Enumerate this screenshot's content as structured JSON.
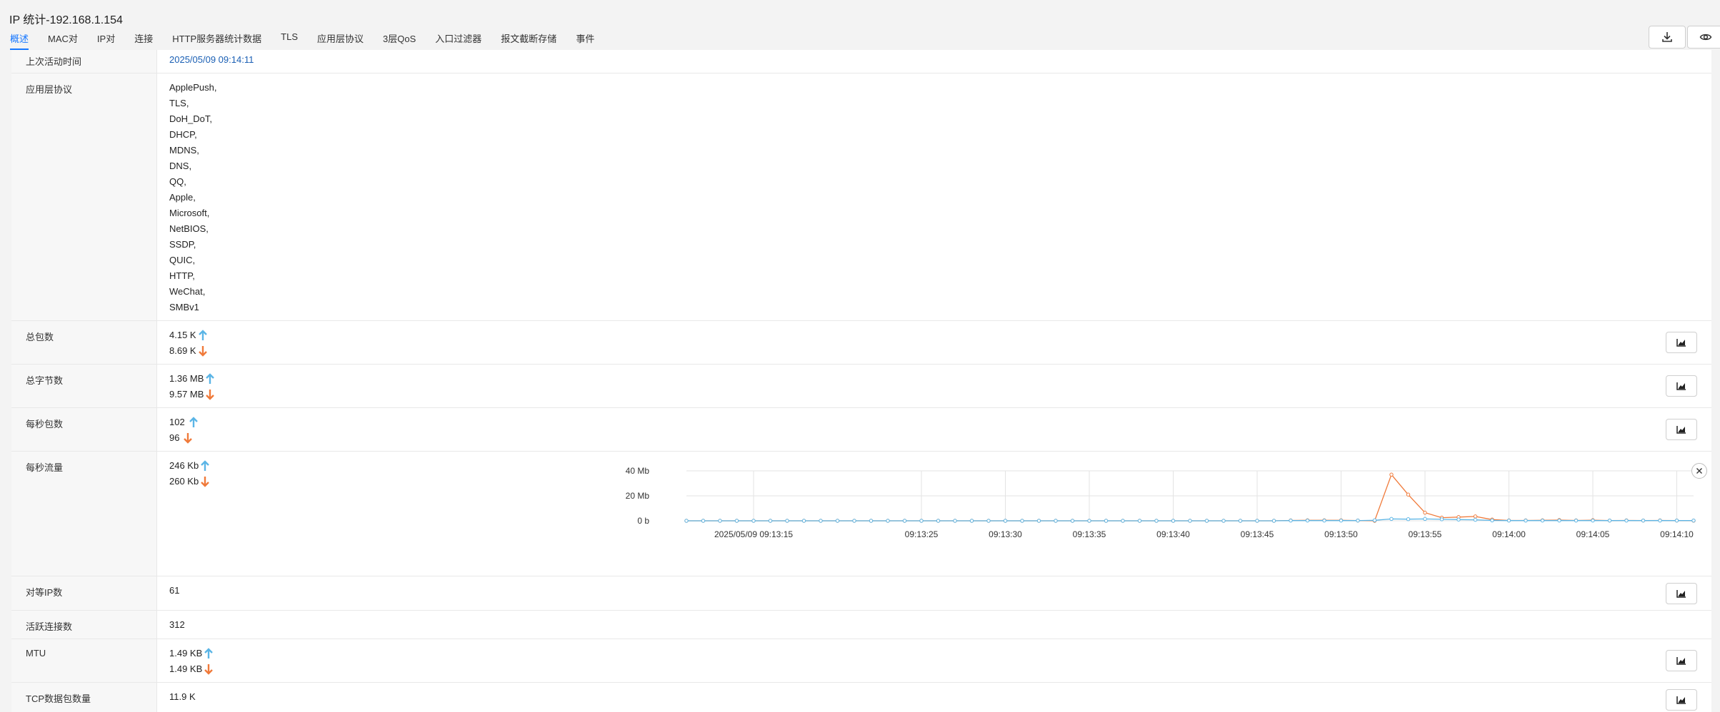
{
  "window": {
    "title": "IP 统计-192.168.1.154"
  },
  "tabs": [
    {
      "label": "概述",
      "active": true
    },
    {
      "label": "MAC对"
    },
    {
      "label": "IP对"
    },
    {
      "label": "连接"
    },
    {
      "label": "HTTP服务器统计数据"
    },
    {
      "label": "TLS"
    },
    {
      "label": "应用层协议"
    },
    {
      "label": "3层QoS"
    },
    {
      "label": "入口过滤器"
    },
    {
      "label": "报文截断存储"
    },
    {
      "label": "事件"
    }
  ],
  "toolbar": {
    "download_icon": "download-icon",
    "view_icon": "eye-icon"
  },
  "rows": {
    "last_active": {
      "label": "上次活动时间",
      "value": "2025/05/09 09:14:11"
    },
    "app_protocols": {
      "label": "应用层协议",
      "values": [
        "ApplePush,",
        "TLS,",
        "DoH_DoT,",
        "DHCP,",
        "MDNS,",
        "DNS,",
        "QQ,",
        "Apple,",
        "Microsoft,",
        "NetBIOS,",
        "SSDP,",
        "QUIC,",
        "HTTP,",
        "WeChat,",
        "SMBv1"
      ]
    },
    "total_packets": {
      "label": "总包数",
      "up": "4.15 K",
      "down": "8.69 K"
    },
    "total_bytes": {
      "label": "总字节数",
      "up": "1.36 MB",
      "down": "9.57 MB"
    },
    "pps": {
      "label": "每秒包数",
      "up": "102",
      "down": "96"
    },
    "bps": {
      "label": "每秒流量",
      "up": "246 Kb",
      "down": "260 Kb"
    },
    "peer_ips": {
      "label": "对等IP数",
      "value": "61"
    },
    "active_conns": {
      "label": "活跃连接数",
      "value": "312"
    },
    "mtu": {
      "label": "MTU",
      "up": "1.49 KB",
      "down": "1.49 KB"
    },
    "tcp_packets": {
      "label": "TCP数据包数量",
      "value": "11.9 K"
    }
  },
  "colors": {
    "up": "#5bb5e6",
    "down": "#f07a3a",
    "link": "#1a5fb4",
    "active_tab": "#1677ff"
  },
  "chart_data": {
    "type": "line",
    "title": "",
    "xlabel": "",
    "ylabel": "",
    "ylim": [
      0,
      40
    ],
    "y_unit": "Mb",
    "y_ticks": [
      "0 b",
      "20 Mb",
      "40 Mb"
    ],
    "y_tick_values": [
      0,
      20,
      40
    ],
    "x_tick_labels": [
      "2025/05/09 09:13:15",
      "09:13:25",
      "09:13:30",
      "09:13:35",
      "09:13:40",
      "09:13:45",
      "09:13:50",
      "09:13:55",
      "09:14:00",
      "09:14:05",
      "09:14:10"
    ],
    "x_tick_seconds": [
      15,
      25,
      30,
      35,
      40,
      45,
      50,
      55,
      60,
      65,
      70
    ],
    "grid": true,
    "legend": "none",
    "x_seconds": [
      11,
      12,
      13,
      14,
      15,
      16,
      17,
      18,
      19,
      20,
      21,
      22,
      23,
      24,
      25,
      26,
      27,
      28,
      29,
      30,
      31,
      32,
      33,
      34,
      35,
      36,
      37,
      38,
      39,
      40,
      41,
      42,
      43,
      44,
      45,
      46,
      47,
      48,
      49,
      50,
      51,
      52,
      53,
      54,
      55,
      56,
      57,
      58,
      59,
      60,
      61,
      62,
      63,
      64,
      65,
      66,
      67,
      68,
      69,
      70,
      71
    ],
    "series": [
      {
        "color": "#f07a3a",
        "values": [
          0,
          0,
          0,
          0,
          0,
          0,
          0,
          0,
          0,
          0,
          0,
          0,
          0,
          0,
          0,
          0,
          0,
          0,
          0,
          0,
          0,
          0,
          0,
          0,
          0,
          0,
          0,
          0,
          0,
          0,
          0,
          0,
          0,
          0,
          0,
          0,
          0.3,
          0.4,
          0.4,
          0.4,
          0.2,
          0,
          37,
          21,
          6.5,
          2.5,
          3,
          3.5,
          1,
          0.3,
          0.3,
          0.4,
          0.6,
          0.3,
          0.5,
          0.2,
          0.3,
          0.2,
          0.3,
          0.2,
          0.1
        ]
      },
      {
        "color": "#5bb5e6",
        "values": [
          0,
          0,
          0,
          0,
          0,
          0,
          0,
          0,
          0,
          0,
          0,
          0,
          0,
          0,
          0,
          0,
          0,
          0,
          0,
          0,
          0,
          0,
          0,
          0,
          0,
          0,
          0,
          0,
          0,
          0,
          0,
          0,
          0,
          0,
          0,
          0,
          0.2,
          0.2,
          0.2,
          0.2,
          0.2,
          0.4,
          1.5,
          1.3,
          1.5,
          1.2,
          1,
          0.8,
          0.3,
          0.2,
          0.2,
          0.2,
          0.2,
          0.2,
          0.2,
          0.2,
          0.2,
          0.2,
          0.2,
          0.2,
          0.2
        ]
      }
    ]
  }
}
